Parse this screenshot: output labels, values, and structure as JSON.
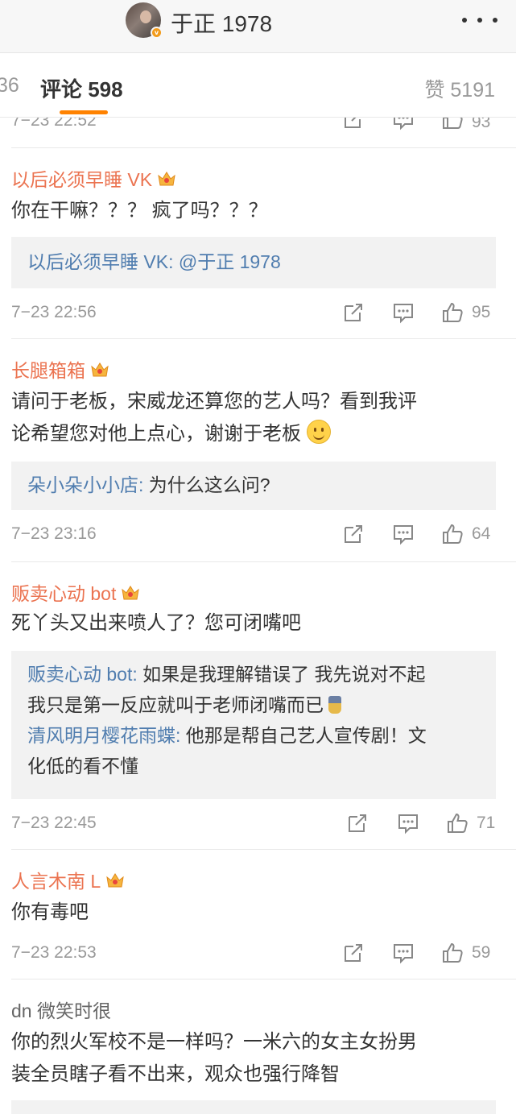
{
  "header": {
    "title": "于正 1978",
    "badge": "v"
  },
  "tabs": {
    "prev": "36",
    "comments": "评论 598",
    "likes": "赞 5191"
  },
  "partial_meta": {
    "time": "7−23 22:52",
    "likes": "93"
  },
  "comments": [
    {
      "user": "以后必须早睡 VK",
      "text": "你在干嘛？？？ 疯了吗？？？",
      "replies": [
        {
          "user": "以后必须早睡 VK:",
          "text": " @于正 1978"
        }
      ],
      "time": "7−23 22:56",
      "likes": "95"
    },
    {
      "user": "长腿箱箱",
      "text_line1": "请问于老板，宋威龙还算您的艺人吗？看到我评",
      "text_line2": "论希望您对他上点心，谢谢于老板",
      "replies": [
        {
          "user": "朵小朵小小店:",
          "text": " 为什么这么问?"
        }
      ],
      "time": "7−23 23:16",
      "likes": "64"
    },
    {
      "user": "贩卖心动 bot",
      "text": "死丫头又出来喷人了？您可闭嘴吧",
      "replies": [
        {
          "user": "贩卖心动 bot:",
          "text": " 如果是我理解错误了 我先说对不起",
          "text2": "我只是第一反应就叫于老师闭嘴而已"
        },
        {
          "user": "清风明月樱花雨蝶:",
          "text": " 他那是帮自己艺人宣传剧！文",
          "text2": "化低的看不懂"
        }
      ],
      "time": "7−23 22:45",
      "likes": "71"
    },
    {
      "user": "人言木南 L",
      "text": "你有毒吧",
      "time": "7−23 22:53",
      "likes": "59"
    },
    {
      "user": "dn 微笑时很",
      "text_line1": "你的烈火军校不是一样吗？一米六的女主女扮男",
      "text_line2": "装全员瞎子看不出来，观众也强行降智"
    }
  ],
  "colors": {
    "username": "#eb7350",
    "reply_user": "#507daf",
    "accent": "#ff8200"
  },
  "icons": [
    "more-icon",
    "share-icon",
    "comment-icon",
    "like-icon",
    "crown-badge-icon",
    "smiley-emoji-icon"
  ]
}
